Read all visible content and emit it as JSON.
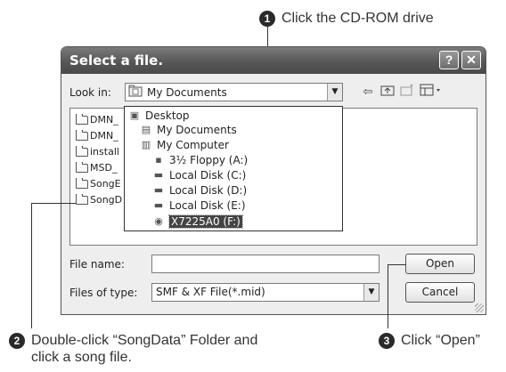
{
  "callouts": {
    "step1": {
      "num": "1",
      "text": "Click the CD-ROM drive"
    },
    "step2": {
      "num": "2",
      "text": "Double-click “SongData” Folder and\nclick a song file."
    },
    "step3": {
      "num": "3",
      "text": "Click “Open”"
    }
  },
  "dialog": {
    "title": "Select a file.",
    "help_label": "?",
    "close_label": "✕",
    "look_in_label": "Look in:",
    "look_in_value": "My Documents",
    "files": [
      "DMN_",
      "DMN_",
      "install",
      "MSD_",
      "SongE",
      "SongD"
    ],
    "dropdown_items": [
      {
        "label": "Desktop",
        "icon": "desktop-icon"
      },
      {
        "label": "My Documents",
        "icon": "documents-icon"
      },
      {
        "label": "My Computer",
        "icon": "computer-icon"
      },
      {
        "label": "3½ Floppy (A:)",
        "icon": "floppy-icon"
      },
      {
        "label": "Local Disk (C:)",
        "icon": "disk-icon"
      },
      {
        "label": "Local Disk (D:)",
        "icon": "disk-icon"
      },
      {
        "label": "Local Disk (E:)",
        "icon": "disk-icon"
      },
      {
        "label": "X7225A0 (F:)",
        "icon": "cdrom-icon",
        "selected": true
      }
    ],
    "file_name_label": "File name:",
    "file_name_value": "",
    "files_of_type_label": "Files of type:",
    "files_of_type_value": "SMF & XF File(*.mid)",
    "open_label": "Open",
    "cancel_label": "Cancel"
  }
}
